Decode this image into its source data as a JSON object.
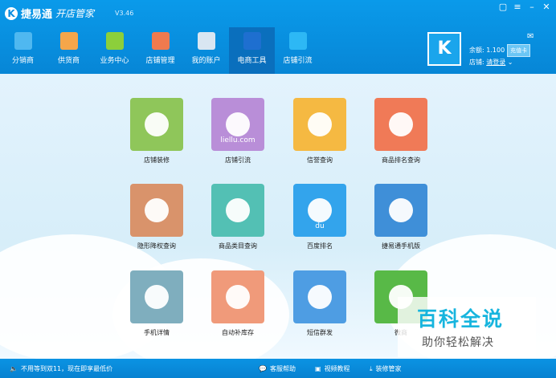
{
  "app": {
    "name": "捷易通",
    "subtitle": "开店管家",
    "version": "V3.46"
  },
  "nav": [
    {
      "label": "分销商",
      "color": "#4fb8f0"
    },
    {
      "label": "供货商",
      "color": "#f5a64a"
    },
    {
      "label": "业务中心",
      "color": "#8ccf3b"
    },
    {
      "label": "店铺管理",
      "color": "#f07a4e"
    },
    {
      "label": "我的账户",
      "color": "#d9e6f2"
    },
    {
      "label": "电商工具",
      "color": "#1e6fd0"
    },
    {
      "label": "店铺引流",
      "color": "#2db8f5"
    }
  ],
  "account": {
    "balance_label": "余额:",
    "balance_value": "1.100",
    "recharge": "充值卡",
    "shop_label": "店铺:",
    "shop_link": "请登录"
  },
  "tiles": [
    {
      "label": "店铺装修",
      "color": "#8fc65a",
      "icon": "paint-roller-icon"
    },
    {
      "label": "店铺引流",
      "color": "#b98ed8",
      "icon": "liellu-logo-icon",
      "text": "liellu.com"
    },
    {
      "label": "信誉查询",
      "color": "#f5b942",
      "icon": "diamond-icon"
    },
    {
      "label": "商品排名查询",
      "color": "#f07a57",
      "icon": "chart-search-icon"
    },
    {
      "label": "隐形降权查询",
      "color": "#d9936b",
      "icon": "user-download-icon"
    },
    {
      "label": "商品类目查询",
      "color": "#53c0b4",
      "icon": "list-icon"
    },
    {
      "label": "百度排名",
      "color": "#33a4ec",
      "icon": "baidu-paw-icon",
      "text": "du"
    },
    {
      "label": "捷易通手机版",
      "color": "#3f8fd8",
      "icon": "phone-k-icon"
    },
    {
      "label": "手机详情",
      "color": "#7faebe",
      "icon": "phone-touch-icon"
    },
    {
      "label": "自动补库存",
      "color": "#f09a7a",
      "icon": "box-icon"
    },
    {
      "label": "短信群发",
      "color": "#4e9de3",
      "icon": "chat-bubble-icon"
    },
    {
      "label": "微商",
      "color": "#58b947",
      "icon": "wechat-icon"
    }
  ],
  "status": {
    "notice": "不用等到双11，现在即享最低价",
    "help": "客服帮助",
    "video": "视频教程",
    "install": "装修管家"
  },
  "watermark": {
    "title": "百科全说",
    "subtitle": "助你轻松解决"
  }
}
